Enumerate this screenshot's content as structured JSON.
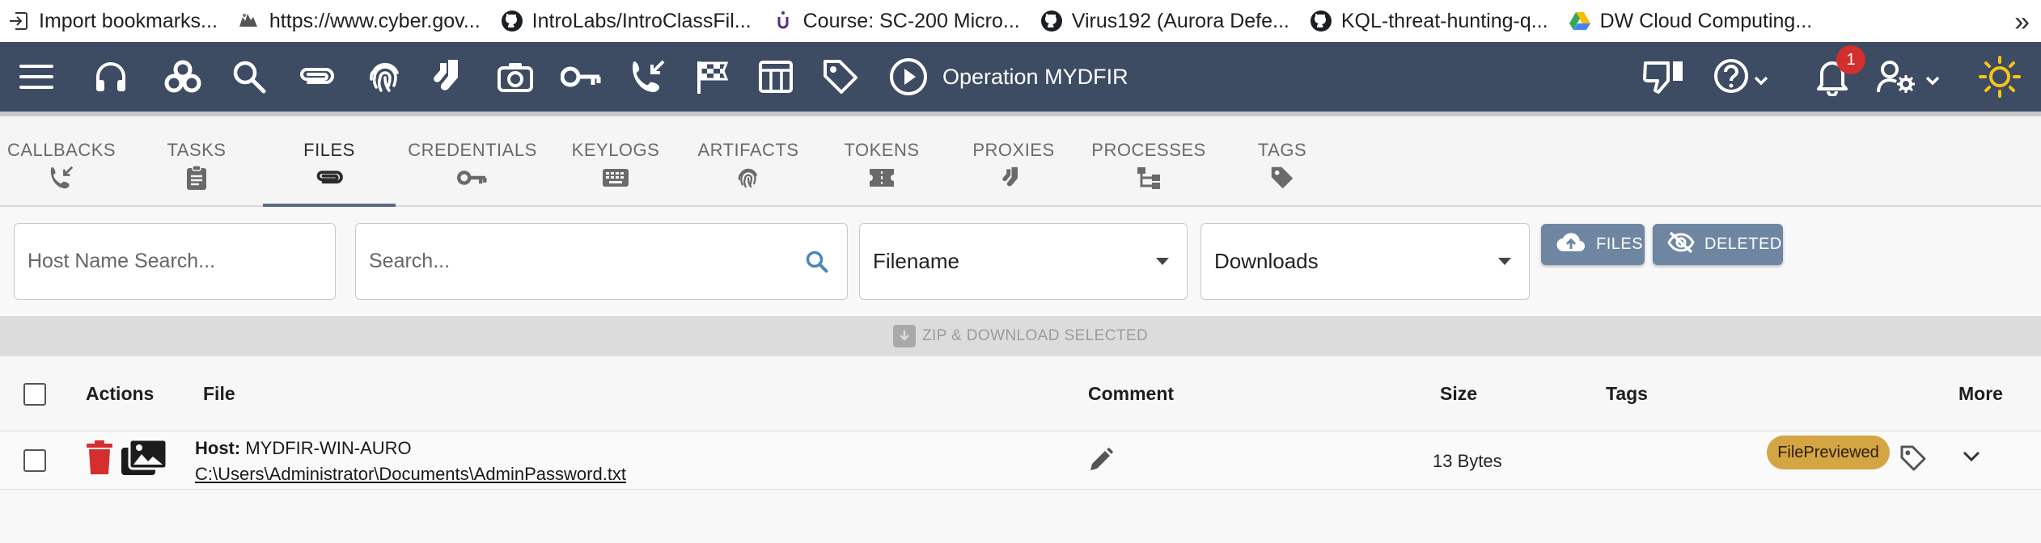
{
  "colors": {
    "appbar": "#3d4b63",
    "button_chip": "#6f86a3",
    "tag_chip": "#d4a543",
    "delete_red": "#d32f2f",
    "sun": "#f5c518",
    "search_blue": "#4a87b9"
  },
  "bookmarks": [
    {
      "icon": "import-icon",
      "label": "Import bookmarks..."
    },
    {
      "icon": "flag-site-icon",
      "label": "https://www.cyber.gov..."
    },
    {
      "icon": "github-icon",
      "label": "IntroLabs/IntroClassFil..."
    },
    {
      "icon": "course-icon",
      "label": "Course: SC-200 Micro..."
    },
    {
      "icon": "github-icon",
      "label": "Virus192 (Aurora Defe..."
    },
    {
      "icon": "github-icon",
      "label": "KQL-threat-hunting-q..."
    },
    {
      "icon": "drive-icon",
      "label": "DW Cloud Computing..."
    }
  ],
  "bookmarks_overflow": "»",
  "appbar": {
    "operation_title": "Operation MYDFIR",
    "notification_count": "1"
  },
  "tabs": [
    {
      "label": "CALLBACKS",
      "icon": "phone-callback-icon"
    },
    {
      "label": "TASKS",
      "icon": "clipboard-icon"
    },
    {
      "label": "FILES",
      "icon": "paperclip-icon",
      "active": true
    },
    {
      "label": "CREDENTIALS",
      "icon": "key-icon"
    },
    {
      "label": "KEYLOGS",
      "icon": "keyboard-icon"
    },
    {
      "label": "ARTIFACTS",
      "icon": "fingerprint-icon"
    },
    {
      "label": "TOKENS",
      "icon": "ticket-icon"
    },
    {
      "label": "PROXIES",
      "icon": "socks-icon"
    },
    {
      "label": "PROCESSES",
      "icon": "tree-icon"
    },
    {
      "label": "TAGS",
      "icon": "tag-icon"
    }
  ],
  "filters": {
    "host_placeholder": "Host Name Search...",
    "search_placeholder": "Search...",
    "field_select": "Filename",
    "type_select": "Downloads",
    "files_button": "FILES",
    "deleted_button": "DELETED"
  },
  "zip_button": "ZIP & DOWNLOAD SELECTED",
  "table": {
    "headers": {
      "actions": "Actions",
      "file": "File",
      "comment": "Comment",
      "size": "Size",
      "tags": "Tags",
      "more": "More"
    },
    "rows": [
      {
        "host_label": "Host:",
        "host": "MYDFIR-WIN-AURO",
        "path": "C:\\Users\\Administrator\\Documents\\AdminPassword.txt",
        "size": "13 Bytes",
        "tag": "FilePreviewed"
      }
    ]
  }
}
